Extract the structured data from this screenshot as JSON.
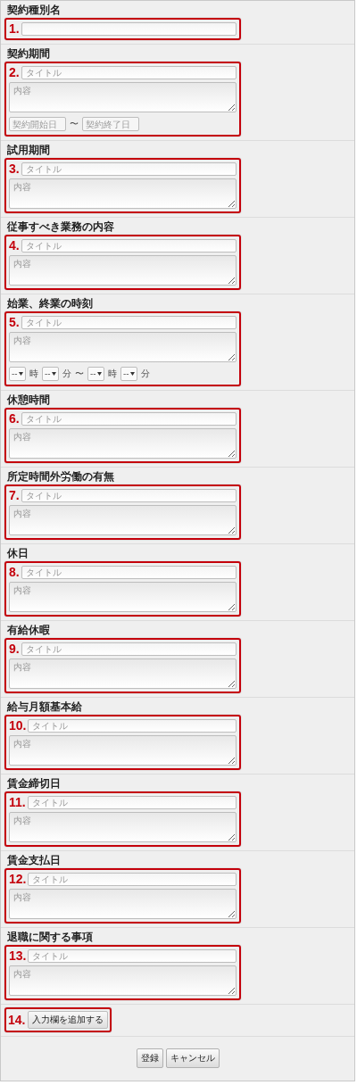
{
  "sections": [
    {
      "kind": "name",
      "label": "契約種別名",
      "annotation": "1."
    },
    {
      "kind": "period",
      "label": "契約期間",
      "annotation": "2.",
      "title_placeholder": "タイトル",
      "content_placeholder": "内容",
      "start_placeholder": "契約開始日",
      "separator": "〜",
      "end_placeholder": "契約終了日"
    },
    {
      "kind": "text",
      "label": "試用期間",
      "annotation": "3.",
      "title_placeholder": "タイトル",
      "content_placeholder": "内容"
    },
    {
      "kind": "text",
      "label": "従事すべき業務の内容",
      "annotation": "4.",
      "title_placeholder": "タイトル",
      "content_placeholder": "内容"
    },
    {
      "kind": "time",
      "label": "始業、終業の時刻",
      "annotation": "5.",
      "title_placeholder": "タイトル",
      "content_placeholder": "内容",
      "time_parts": [
        {
          "kind": "select",
          "value": "--"
        },
        {
          "kind": "unit",
          "text": "時"
        },
        {
          "kind": "select",
          "value": "--"
        },
        {
          "kind": "unit",
          "text": "分"
        },
        {
          "kind": "unit",
          "text": "〜"
        },
        {
          "kind": "select",
          "value": "--"
        },
        {
          "kind": "unit",
          "text": "時"
        },
        {
          "kind": "select",
          "value": "--"
        },
        {
          "kind": "unit",
          "text": "分"
        }
      ]
    },
    {
      "kind": "text",
      "label": "休憩時間",
      "annotation": "6.",
      "title_placeholder": "タイトル",
      "content_placeholder": "内容"
    },
    {
      "kind": "text",
      "label": "所定時間外労働の有無",
      "annotation": "7.",
      "title_placeholder": "タイトル",
      "content_placeholder": "内容"
    },
    {
      "kind": "text",
      "label": "休日",
      "annotation": "8.",
      "title_placeholder": "タイトル",
      "content_placeholder": "内容"
    },
    {
      "kind": "text",
      "label": "有給休暇",
      "annotation": "9.",
      "title_placeholder": "タイトル",
      "content_placeholder": "内容"
    },
    {
      "kind": "text",
      "label": "給与月額基本給",
      "annotation": "10.",
      "title_placeholder": "タイトル",
      "content_placeholder": "内容"
    },
    {
      "kind": "text",
      "label": "賃金締切日",
      "annotation": "11.",
      "title_placeholder": "タイトル",
      "content_placeholder": "内容"
    },
    {
      "kind": "text",
      "label": "賃金支払日",
      "annotation": "12.",
      "title_placeholder": "タイトル",
      "content_placeholder": "内容"
    },
    {
      "kind": "text",
      "label": "退職に関する事項",
      "annotation": "13.",
      "title_placeholder": "タイトル",
      "content_placeholder": "内容"
    }
  ],
  "add_field": {
    "label": "入力欄を追加する",
    "annotation": "14."
  },
  "buttons": [
    "登録",
    "キャンセル"
  ]
}
